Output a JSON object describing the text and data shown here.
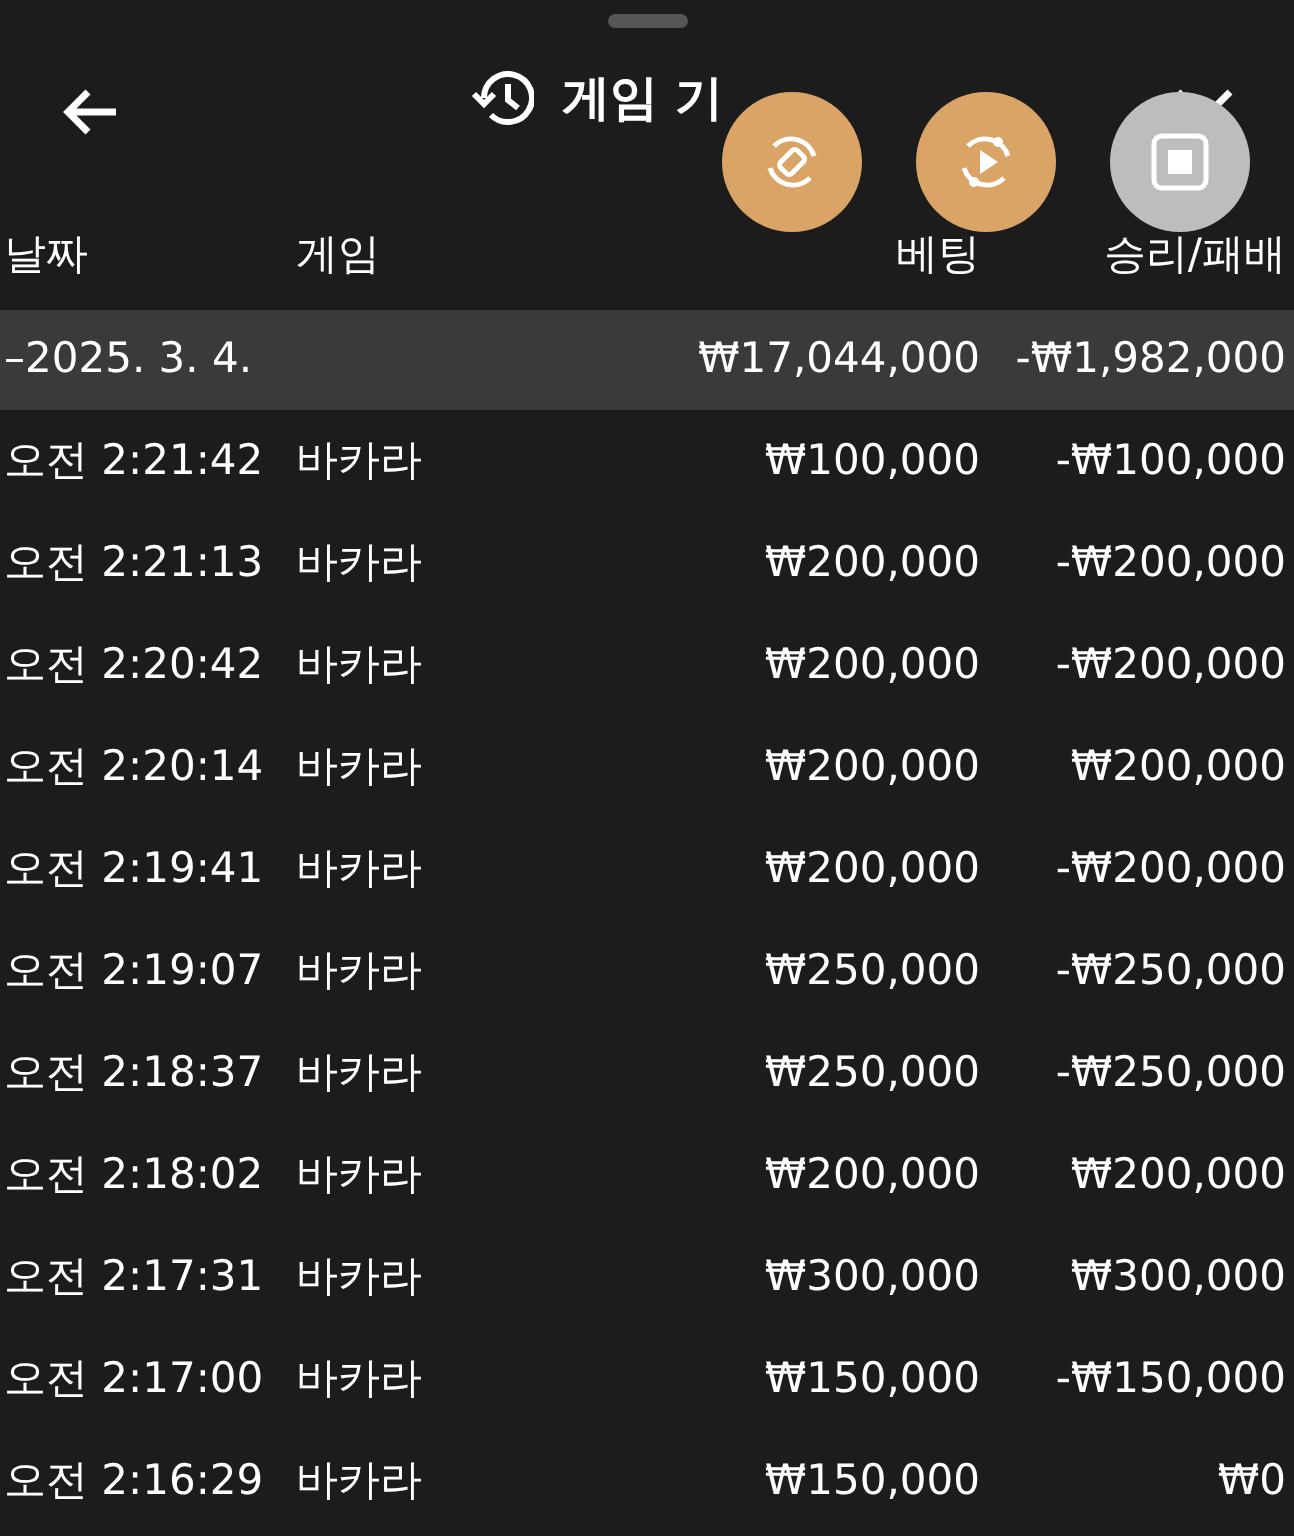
{
  "header": {
    "title": "게임 기"
  },
  "columns": [
    "날짜",
    "게임",
    "베팅",
    "승리/패배"
  ],
  "group": {
    "date": "–2025. 3. 4.",
    "bet": "₩17,044,000",
    "result": "-₩1,982,000"
  },
  "rows": [
    {
      "time": "오전 2:21:42",
      "game": "바카라",
      "bet": "₩100,000",
      "result": "-₩100,000"
    },
    {
      "time": "오전 2:21:13",
      "game": "바카라",
      "bet": "₩200,000",
      "result": "-₩200,000"
    },
    {
      "time": "오전 2:20:42",
      "game": "바카라",
      "bet": "₩200,000",
      "result": "-₩200,000"
    },
    {
      "time": "오전 2:20:14",
      "game": "바카라",
      "bet": "₩200,000",
      "result": "₩200,000"
    },
    {
      "time": "오전 2:19:41",
      "game": "바카라",
      "bet": "₩200,000",
      "result": "-₩200,000"
    },
    {
      "time": "오전 2:19:07",
      "game": "바카라",
      "bet": "₩250,000",
      "result": "-₩250,000"
    },
    {
      "time": "오전 2:18:37",
      "game": "바카라",
      "bet": "₩250,000",
      "result": "-₩250,000"
    },
    {
      "time": "오전 2:18:02",
      "game": "바카라",
      "bet": "₩200,000",
      "result": "₩200,000"
    },
    {
      "time": "오전 2:17:31",
      "game": "바카라",
      "bet": "₩300,000",
      "result": "₩300,000"
    },
    {
      "time": "오전 2:17:00",
      "game": "바카라",
      "bet": "₩150,000",
      "result": "-₩150,000"
    },
    {
      "time": "오전 2:16:29",
      "game": "바카라",
      "bet": "₩150,000",
      "result": "₩0"
    }
  ]
}
